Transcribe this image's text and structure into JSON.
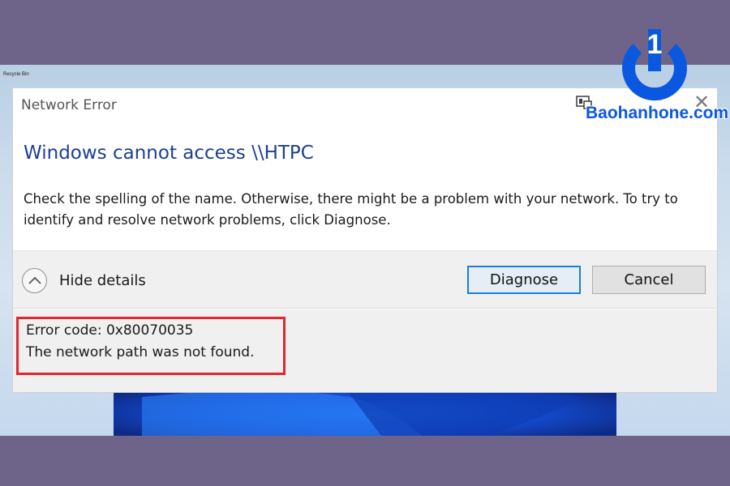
{
  "desktop": {
    "recycle_bin_label": "Recycle Bin"
  },
  "dialog": {
    "title": "Network Error",
    "heading": "Windows cannot access \\\\HTPC",
    "message": "Check the spelling of the name. Otherwise, there might be a problem with your network. To try to identify and resolve network problems, click Diagnose.",
    "hide_details_label": "Hide details",
    "diagnose_label": "Diagnose",
    "cancel_label": "Cancel",
    "close_glyph": "✕",
    "error_code_line": "Error code: 0x80070035",
    "error_message_line": "The network path was not found."
  },
  "watermark": {
    "brand_text": "Baohanhone.com",
    "logo_digit": "1"
  },
  "colors": {
    "frame_background": "#6e6489",
    "heading_blue": "#1c3f93",
    "highlight_red": "#e0272f",
    "focus_blue": "#1b7fd2",
    "logo_blue": "#0a58e0"
  },
  "icons": {
    "title_bar": "window-snap-icon",
    "close": "close-icon",
    "details_toggle": "chevron-up-icon",
    "logo": "power-icon"
  }
}
